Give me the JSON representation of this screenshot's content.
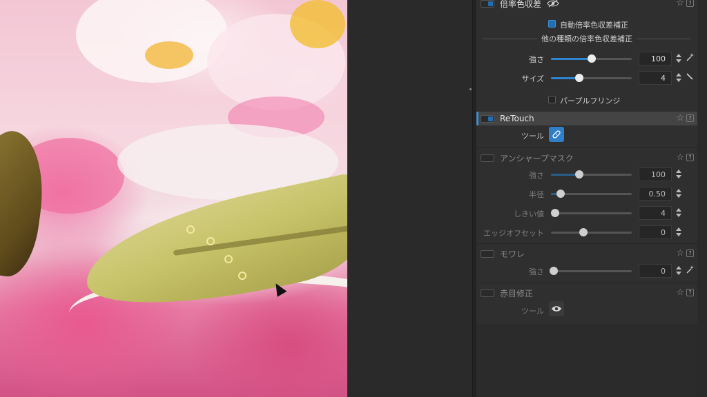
{
  "panel": {
    "lateral_ca": {
      "title": "倍率色収差",
      "auto_checkbox_label": "自動倍率色収差補正",
      "subheading": "他の種類の倍率色収差補正",
      "strength_label": "強さ",
      "strength_value": "100",
      "size_label": "サイズ",
      "size_value": "4",
      "purple_fringe_label": "パープルフリンジ"
    },
    "retouch": {
      "title": "ReTouch",
      "tool_label": "ツール"
    },
    "unsharp_mask": {
      "title": "アンシャープマスク",
      "strength_label": "強さ",
      "strength_value": "100",
      "radius_label": "半径",
      "radius_value": "0.50",
      "threshold_label": "しきい値",
      "threshold_value": "4",
      "edge_offset_label": "エッジオフセット",
      "edge_offset_value": "0"
    },
    "moire": {
      "title": "モワレ",
      "strength_label": "強さ",
      "strength_value": "0"
    },
    "red_eye": {
      "title": "赤目修正",
      "tool_label": "ツール"
    },
    "help_glyph": "?",
    "star_glyph": "☆"
  },
  "sliders": {
    "ca_strength": 0.5,
    "ca_size": 0.35,
    "usm_strength": 0.35,
    "usm_radius": 0.12,
    "usm_threshold": 0.05,
    "usm_edge_offset": 0.4,
    "moire_strength": 0.03
  },
  "colors": {
    "accent": "#2f86d0",
    "panel_bg": "#2f2f2f",
    "active_section_bg": "#444444"
  }
}
